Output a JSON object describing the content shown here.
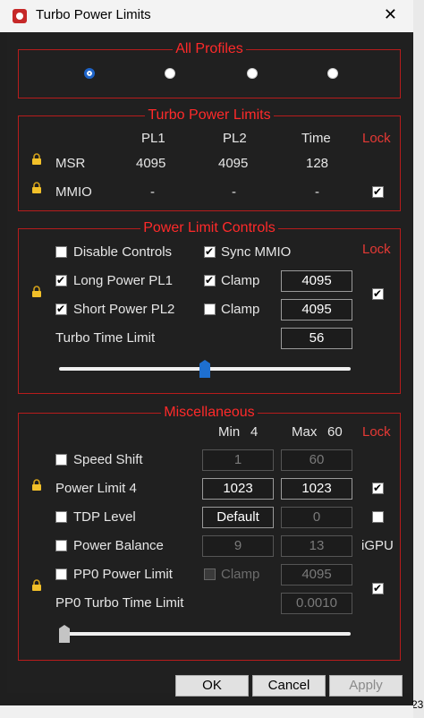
{
  "window": {
    "title": "Turbo Power Limits",
    "close_glyph": "✕"
  },
  "frame": {
    "right_number": "23"
  },
  "all_profiles": {
    "legend": "All Profiles",
    "selected": 0
  },
  "turbo": {
    "legend": "Turbo Power Limits",
    "cols": [
      "PL1",
      "PL2",
      "Time"
    ],
    "lock": "Lock",
    "rows": [
      {
        "label": "MSR",
        "pl1": "4095",
        "pl2": "4095",
        "time": "128"
      },
      {
        "label": "MMIO",
        "pl1": "-",
        "pl2": "-",
        "time": "-"
      }
    ],
    "mmio_lock_checked": true
  },
  "controls": {
    "legend": "Power Limit Controls",
    "lock": "Lock",
    "disable_controls": "Disable Controls",
    "sync_mmio": "Sync MMIO",
    "long_pl1": "Long Power PL1",
    "clamp": "Clamp",
    "long_value": "4095",
    "short_pl2": "Short Power PL2",
    "short_value": "4095",
    "turbo_time_limit": "Turbo Time Limit",
    "ttl_value": "56",
    "slider_fraction": 0.5,
    "lock_checked": true
  },
  "misc": {
    "legend": "Miscellaneous",
    "min_label": "Min",
    "min_value": "4",
    "max_label": "Max",
    "max_value": "60",
    "lock": "Lock",
    "speed_shift": "Speed Shift",
    "ss_min": "1",
    "ss_max": "60",
    "power_limit_4": "Power Limit 4",
    "pl4_min": "1023",
    "pl4_max": "1023",
    "tdp_level": "TDP Level",
    "tdp_value": "Default",
    "tdp_max": "0",
    "power_balance": "Power Balance",
    "pb_min": "9",
    "pb_max": "13",
    "igpu": "iGPU",
    "pp0_power_limit": "PP0 Power Limit",
    "clamp": "Clamp",
    "pp0_value": "4095",
    "pp0_turbo_time_limit": "PP0 Turbo Time Limit",
    "pp0_ttl_value": "0.0010",
    "slider_fraction": 0.0
  },
  "buttons": {
    "ok": "OK",
    "cancel": "Cancel",
    "apply": "Apply"
  }
}
